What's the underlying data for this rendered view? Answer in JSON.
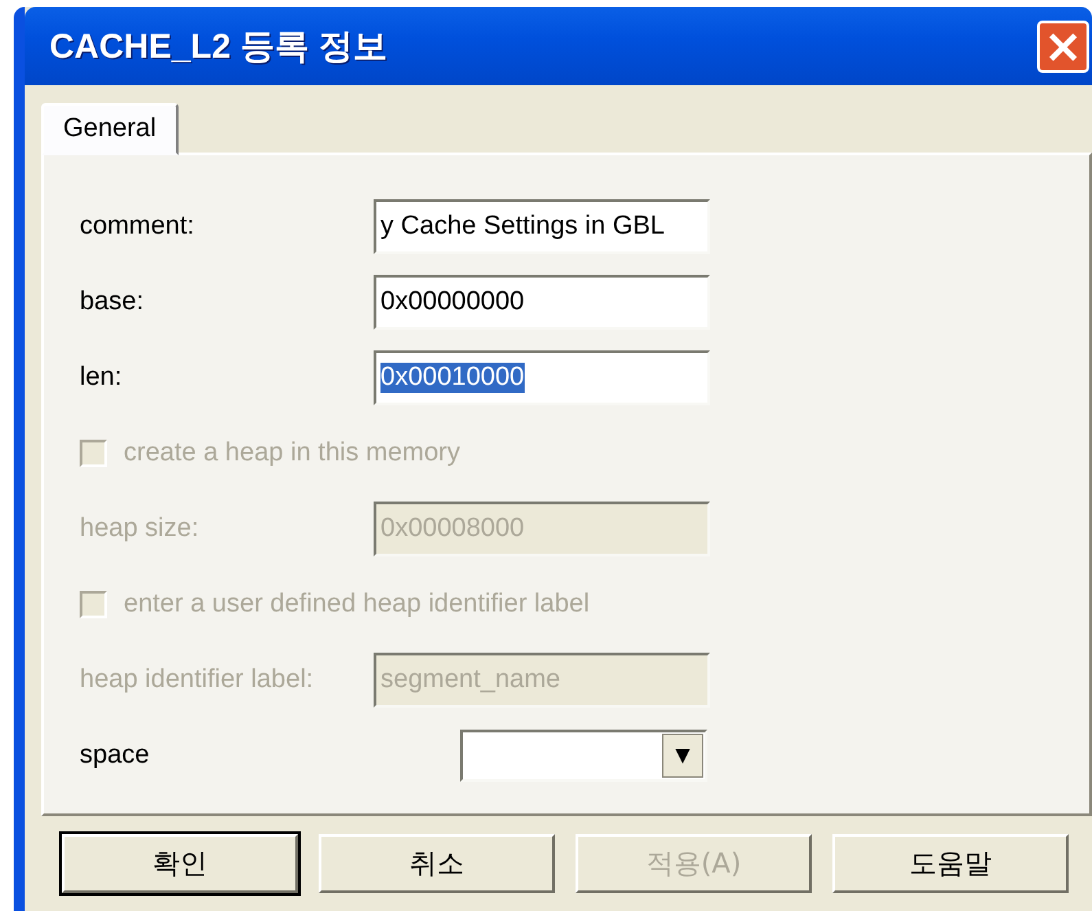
{
  "window": {
    "title": "CACHE_L2 등록 정보",
    "close": "×"
  },
  "tabs": [
    {
      "label": "General",
      "selected": true
    }
  ],
  "rows": [
    {
      "kind": "field",
      "label": "comment:",
      "value": "y Cache Settings in GBL",
      "disabled": false,
      "selected": false
    },
    {
      "kind": "field",
      "label": "base:",
      "value": "0x00000000",
      "disabled": false,
      "selected": false
    },
    {
      "kind": "field",
      "label": "len:",
      "value": "0x00010000",
      "disabled": false,
      "selected": true
    },
    {
      "kind": "checkbox",
      "label": "create a heap in this memory",
      "checked": false,
      "disabled": true
    },
    {
      "kind": "field",
      "label": "heap size:",
      "value": "0x00008000",
      "disabled": true,
      "selected": false
    },
    {
      "kind": "checkbox",
      "label": "enter a user defined heap identifier label",
      "checked": false,
      "disabled": true
    },
    {
      "kind": "field",
      "label": "heap identifier label:",
      "value": "segment_name",
      "disabled": true,
      "selected": false
    },
    {
      "kind": "dropdown",
      "label": "space",
      "arrow": "▼"
    }
  ],
  "buttons": [
    {
      "label": "확인",
      "default": true,
      "disabled": false
    },
    {
      "label": "취소",
      "default": false,
      "disabled": false
    },
    {
      "label": "적용(A)",
      "default": false,
      "disabled": true
    },
    {
      "label": "도움말",
      "default": false,
      "disabled": false
    }
  ]
}
